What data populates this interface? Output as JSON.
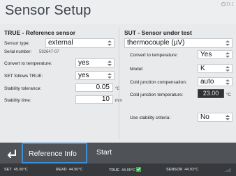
{
  "header": {
    "title": "Sensor Setup",
    "clock": "11:1"
  },
  "left": {
    "heading": "TRUE - Reference sensor",
    "sensor_type": {
      "label": "Sensor type:",
      "value": "external"
    },
    "serial": {
      "label": "Serial number:",
      "value": "592647-07"
    },
    "convert": {
      "label": "Convert to temperature:",
      "value": "yes"
    },
    "follows": {
      "label": "SET follows TRUE:",
      "value": "yes"
    },
    "tolerance": {
      "label": "Stability tolerance:",
      "value": "0.05",
      "unit": "°C"
    },
    "time": {
      "label": "Stability time:",
      "value": "10",
      "unit": "min"
    }
  },
  "right": {
    "heading": "SUT - Sensor under test",
    "sensor_type": "thermocouple (µV)",
    "convert": {
      "label": "Convert to temperature:",
      "value": "Yes"
    },
    "model": {
      "label": "Model:",
      "value": "K"
    },
    "cjc": {
      "label": "Cold junction compensation:",
      "value": "auto"
    },
    "cjt": {
      "label": "Cold junction temperature:",
      "value": "23.00",
      "unit": "°C"
    },
    "stability": {
      "label": "Use stability criteria:",
      "value": "No"
    }
  },
  "bottom": {
    "reference_info": "Reference Info",
    "start": "Start"
  },
  "status": {
    "set_label": "SET",
    "set_value": "45.00°C",
    "read_label": "READ",
    "read_value": "44.90°C",
    "true_label": "TRUE",
    "true_value": "44.95°C",
    "sensor_label": "SENSOR",
    "sensor_value": "44.92°C"
  },
  "icons": {
    "back": "back-arrow-icon",
    "stable": "check-icon",
    "clock": "clock-icon",
    "signal": "signal-icon"
  },
  "colors": {
    "accent": "#3b8fd6",
    "bottom_bar": "#4f5257",
    "status_bar": "#37393c",
    "stable_ok": "#39a845"
  }
}
